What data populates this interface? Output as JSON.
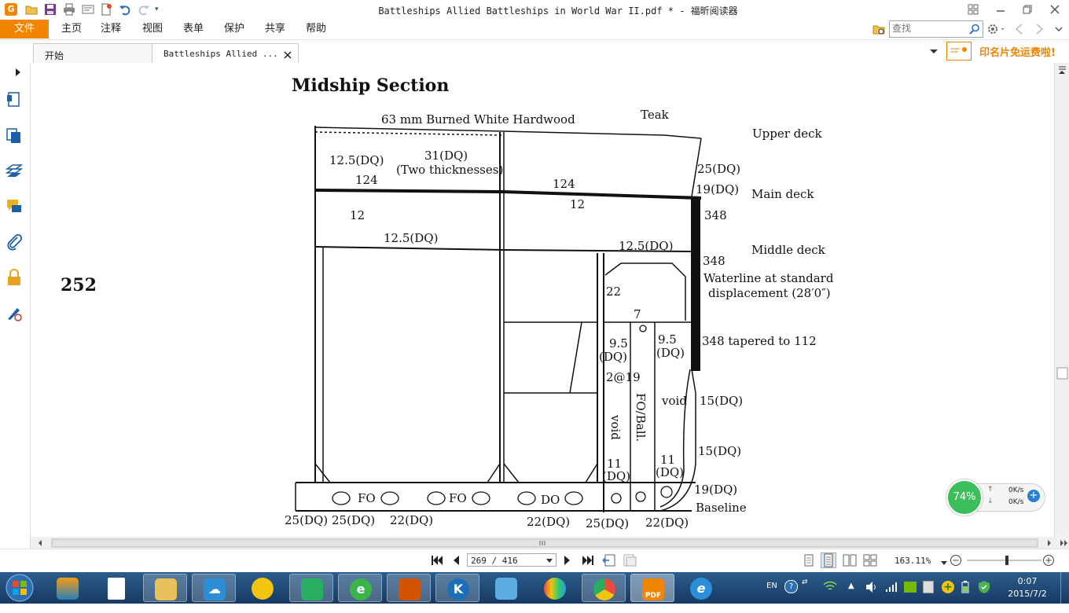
{
  "window": {
    "title": "Battleships Allied Battleships in World War II.pdf * - 福昕阅读器"
  },
  "menu": {
    "file": "文件",
    "items": [
      "主页",
      "注释",
      "视图",
      "表单",
      "保护",
      "共享",
      "帮助"
    ],
    "search_placeholder": "查找"
  },
  "tabs": {
    "start": "开始",
    "doc": "Battleships Allied ...",
    "ad_text": "印名片免运费啦!"
  },
  "document": {
    "page_number": "252",
    "title": "Midship Section",
    "labels": {
      "hardwood": "63 mm Burned White Hardwood",
      "teak": "Teak",
      "upper_deck": "Upper deck",
      "main_deck": "Main deck",
      "middle_deck": "Middle deck",
      "waterline_1": "Waterline at standard",
      "waterline_2": "displacement (28′0″)",
      "tapered": "348 tapered to 112",
      "baseline": "Baseline",
      "dq125a": "12.5(DQ)",
      "dq31": "31(DQ)",
      "two_thick": "(Two thicknesses)",
      "n124a": "124",
      "n124b": "124",
      "n12a": "12",
      "n12b": "12",
      "dq125b": "12.5(DQ)",
      "dq125c": "12.5(DQ)",
      "dq25a": "25(DQ)",
      "dq19a": "19(DQ)",
      "n348a": "348",
      "n348b": "348",
      "n22": "22",
      "n7": "7",
      "n95a": "9.5",
      "dqa": "(DQ)",
      "n95b": "9.5",
      "dqb": "(DQ)",
      "n2at19": "2@19",
      "void_v": "void",
      "foball": "FO/Ball.",
      "void_h": "void",
      "dq15a": "15(DQ)",
      "dq15b": "15(DQ)",
      "n11a": "11",
      "dqc": "(DQ)",
      "n11b": "11",
      "dqd": "(DQ)",
      "dq19b": "19(DQ)",
      "fo1": "FO",
      "fo2": "FO",
      "do1": "DO",
      "b25a": "25(DQ)",
      "b25b": "25(DQ)",
      "b22a": "22(DQ)",
      "b22b": "22(DQ)",
      "b25c": "25(DQ)",
      "b22c": "22(DQ)"
    }
  },
  "status": {
    "page": "269 / 416",
    "zoom": "163.11%"
  },
  "perf": {
    "percent": "74%",
    "up": "0K/s",
    "down": "0K/s"
  },
  "taskbar": {
    "lang": "EN",
    "time": "0:07",
    "date": "2015/7/2"
  },
  "colors": {
    "accent": "#f28500",
    "taskbar": "#1f4a78"
  }
}
